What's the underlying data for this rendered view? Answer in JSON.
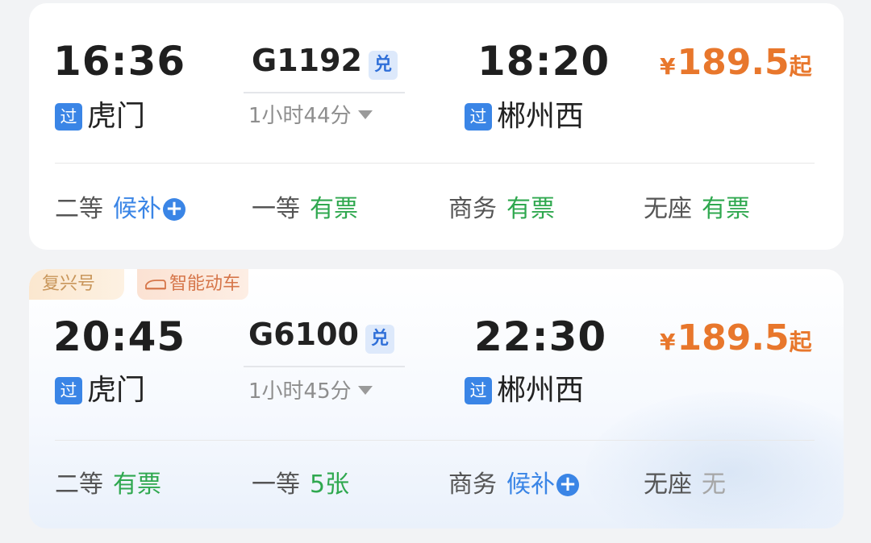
{
  "colors": {
    "price": "#e8772c",
    "available_green": "#2fa84f",
    "waitlist_blue": "#3a85e6",
    "none_gray": "#a6a6a6"
  },
  "trains": [
    {
      "depart_time": "16:36",
      "train_no": "G1192",
      "exchange_badge": "兑",
      "duration": "1小时44分",
      "arrive_time": "18:20",
      "from_badge": "过",
      "from_station": "虎门",
      "to_badge": "过",
      "to_station": "郴州西",
      "price_symbol": "¥",
      "price_amount": "189.5",
      "price_suffix": "起",
      "seats": [
        {
          "class": "二等",
          "status": "候补",
          "kind": "waitlist"
        },
        {
          "class": "一等",
          "status": "有票",
          "kind": "available"
        },
        {
          "class": "商务",
          "status": "有票",
          "kind": "available"
        },
        {
          "class": "无座",
          "status": "有票",
          "kind": "available"
        }
      ]
    },
    {
      "tags": [
        "复兴号",
        "智能动车"
      ],
      "depart_time": "20:45",
      "train_no": "G6100",
      "exchange_badge": "兑",
      "duration": "1小时45分",
      "arrive_time": "22:30",
      "from_badge": "过",
      "from_station": "虎门",
      "to_badge": "过",
      "to_station": "郴州西",
      "price_symbol": "¥",
      "price_amount": "189.5",
      "price_suffix": "起",
      "seats": [
        {
          "class": "二等",
          "status": "有票",
          "kind": "available"
        },
        {
          "class": "一等",
          "status": "5张",
          "kind": "available"
        },
        {
          "class": "商务",
          "status": "候补",
          "kind": "waitlist"
        },
        {
          "class": "无座",
          "status": "无",
          "kind": "none"
        }
      ]
    }
  ]
}
